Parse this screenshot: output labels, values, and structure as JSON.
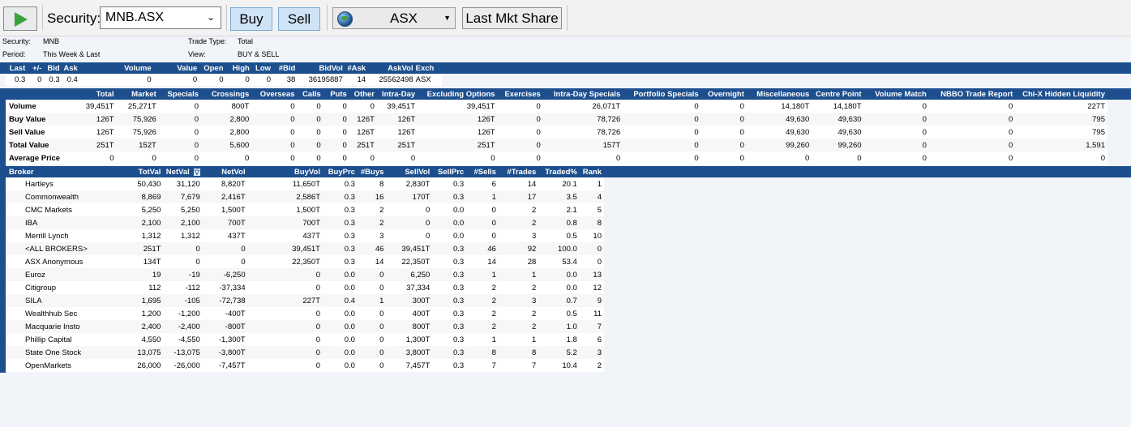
{
  "toolbar": {
    "security_label": "Security:",
    "security_value": "MNB.ASX",
    "buy_label": "Buy",
    "sell_label": "Sell",
    "exchange_value": "ASX",
    "last_mkt_share_label": "Last Mkt Share"
  },
  "info": {
    "security_label": "Security:",
    "security_value": "MNB",
    "period_label": "Period:",
    "period_value": "This Week & Last",
    "trade_type_label": "Trade Type:",
    "trade_type_value": "Total",
    "view_label": "View:",
    "view_value": "BUY & SELL"
  },
  "quote": {
    "headers": [
      "Last",
      "+/-",
      "Bid",
      "Ask",
      "Volume",
      "Value",
      "Open",
      "High",
      "Low",
      "#Bid",
      "BidVol",
      "#Ask",
      "AskVol",
      "Exch"
    ],
    "values": [
      "0.3",
      "0",
      "0.3",
      "0.4",
      "0",
      "0",
      "0",
      "0",
      "0",
      "38",
      "36195887",
      "14",
      "25562498",
      "ASX"
    ]
  },
  "summary": {
    "headers": [
      "",
      "Total",
      "Market",
      "Specials",
      "Crossings",
      "Overseas",
      "Calls",
      "Puts",
      "Other",
      "Intra-Day",
      "Excluding Options",
      "Exercises",
      "Intra-Day Specials",
      "Portfolio Specials",
      "Overnight",
      "Miscellaneous",
      "Centre Point",
      "Volume Match",
      "NBBO Trade Report",
      "Chi-X Hidden Liquidity"
    ],
    "rows": [
      [
        "Volume",
        "39,451T",
        "25,271T",
        "0",
        "800T",
        "0",
        "0",
        "0",
        "0",
        "39,451T",
        "39,451T",
        "0",
        "26,071T",
        "0",
        "0",
        "14,180T",
        "14,180T",
        "0",
        "0",
        "227T"
      ],
      [
        "Buy Value",
        "126T",
        "75,926",
        "0",
        "2,800",
        "0",
        "0",
        "0",
        "126T",
        "126T",
        "126T",
        "0",
        "78,726",
        "0",
        "0",
        "49,630",
        "49,630",
        "0",
        "0",
        "795"
      ],
      [
        "Sell Value",
        "126T",
        "75,926",
        "0",
        "2,800",
        "0",
        "0",
        "0",
        "126T",
        "126T",
        "126T",
        "0",
        "78,726",
        "0",
        "0",
        "49,630",
        "49,630",
        "0",
        "0",
        "795"
      ],
      [
        "Total Value",
        "251T",
        "152T",
        "0",
        "5,600",
        "0",
        "0",
        "0",
        "251T",
        "251T",
        "251T",
        "0",
        "157T",
        "0",
        "0",
        "99,260",
        "99,260",
        "0",
        "0",
        "1,591"
      ],
      [
        "Average Price",
        "0",
        "0",
        "0",
        "0",
        "0",
        "0",
        "0",
        "0",
        "0",
        "0",
        "0",
        "0",
        "0",
        "0",
        "0",
        "0",
        "0",
        "0",
        "0"
      ]
    ]
  },
  "broker": {
    "headers": [
      "Broker",
      "TotVal",
      "NetVal",
      "NetVol",
      "BuyVol",
      "BuyPrc",
      "#Buys",
      "SellVol",
      "SellPrc",
      "#Sells",
      "#Trades",
      "Traded%",
      "Rank"
    ],
    "rows": [
      [
        "Hartleys",
        "50,430",
        "31,120",
        "8,820T",
        "11,650T",
        "0.3",
        "8",
        "2,830T",
        "0.3",
        "6",
        "14",
        "20.1",
        "1"
      ],
      [
        "Commonwealth",
        "8,869",
        "7,679",
        "2,416T",
        "2,586T",
        "0.3",
        "16",
        "170T",
        "0.3",
        "1",
        "17",
        "3.5",
        "4"
      ],
      [
        "CMC Markets",
        "5,250",
        "5,250",
        "1,500T",
        "1,500T",
        "0.3",
        "2",
        "0",
        "0.0",
        "0",
        "2",
        "2.1",
        "5"
      ],
      [
        "IBA",
        "2,100",
        "2,100",
        "700T",
        "700T",
        "0.3",
        "2",
        "0",
        "0.0",
        "0",
        "2",
        "0.8",
        "8"
      ],
      [
        "Merrill Lynch",
        "1,312",
        "1,312",
        "437T",
        "437T",
        "0.3",
        "3",
        "0",
        "0.0",
        "0",
        "3",
        "0.5",
        "10"
      ],
      [
        "<ALL BROKERS>",
        "251T",
        "0",
        "0",
        "39,451T",
        "0.3",
        "46",
        "39,451T",
        "0.3",
        "46",
        "92",
        "100.0",
        "0"
      ],
      [
        "ASX Anonymous",
        "134T",
        "0",
        "0",
        "22,350T",
        "0.3",
        "14",
        "22,350T",
        "0.3",
        "14",
        "28",
        "53.4",
        "0"
      ],
      [
        "Euroz",
        "19",
        "-19",
        "-6,250",
        "0",
        "0.0",
        "0",
        "6,250",
        "0.3",
        "1",
        "1",
        "0.0",
        "13"
      ],
      [
        "Citigroup",
        "112",
        "-112",
        "-37,334",
        "0",
        "0.0",
        "0",
        "37,334",
        "0.3",
        "2",
        "2",
        "0.0",
        "12"
      ],
      [
        "SILA",
        "1,695",
        "-105",
        "-72,738",
        "227T",
        "0.4",
        "1",
        "300T",
        "0.3",
        "2",
        "3",
        "0.7",
        "9"
      ],
      [
        "Wealthhub Sec",
        "1,200",
        "-1,200",
        "-400T",
        "0",
        "0.0",
        "0",
        "400T",
        "0.3",
        "2",
        "2",
        "0.5",
        "11"
      ],
      [
        "Macquarie Insto",
        "2,400",
        "-2,400",
        "-800T",
        "0",
        "0.0",
        "0",
        "800T",
        "0.3",
        "2",
        "2",
        "1.0",
        "7"
      ],
      [
        "Phillip Capital",
        "4,550",
        "-4,550",
        "-1,300T",
        "0",
        "0.0",
        "0",
        "1,300T",
        "0.3",
        "1",
        "1",
        "1.8",
        "6"
      ],
      [
        "State One Stock",
        "13,075",
        "-13,075",
        "-3,800T",
        "0",
        "0.0",
        "0",
        "3,800T",
        "0.3",
        "8",
        "8",
        "5.2",
        "3"
      ],
      [
        "OpenMarkets",
        "26,000",
        "-26,000",
        "-7,457T",
        "0",
        "0.0",
        "0",
        "7,457T",
        "0.3",
        "7",
        "7",
        "10.4",
        "2"
      ]
    ]
  }
}
